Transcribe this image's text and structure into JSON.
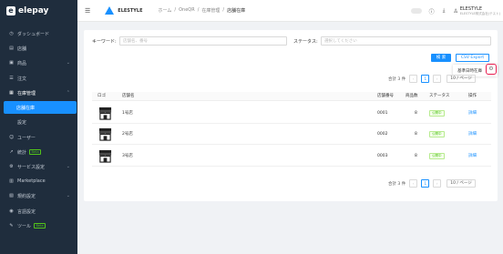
{
  "brand": {
    "name": "elepay",
    "mark": "e"
  },
  "sidebar": {
    "items": [
      {
        "label": "ダッシュボード",
        "icon": "dashboard-icon",
        "glyph": "◷"
      },
      {
        "label": "店舗",
        "icon": "store-icon",
        "glyph": "▤"
      },
      {
        "label": "商品",
        "icon": "product-icon",
        "glyph": "▣"
      },
      {
        "label": "注文",
        "icon": "order-icon",
        "glyph": "☰"
      },
      {
        "label": "在庫管理",
        "icon": "inventory-icon",
        "glyph": "▦"
      },
      {
        "label": "店舗在庫",
        "icon": "",
        "glyph": ""
      },
      {
        "label": "設定",
        "icon": "",
        "glyph": ""
      },
      {
        "label": "ユーザー",
        "icon": "user-icon",
        "glyph": "☺"
      },
      {
        "label": "統計",
        "icon": "stats-icon",
        "glyph": "↗",
        "badge": "Beta"
      },
      {
        "label": "サービス設定",
        "icon": "service-icon",
        "glyph": "⚙"
      },
      {
        "label": "Marketplace",
        "icon": "marketplace-icon",
        "glyph": "▥"
      },
      {
        "label": "規約設定",
        "icon": "terms-icon",
        "glyph": "▧"
      },
      {
        "label": "言語設定",
        "icon": "language-icon",
        "glyph": "◉"
      },
      {
        "label": "ツール",
        "icon": "tool-icon",
        "glyph": "✎",
        "badge": "Beta"
      }
    ]
  },
  "header": {
    "org_name": "ELESTYLE",
    "breadcrumb": [
      "ホーム",
      "OneQR",
      "在庫管理",
      "店舗在庫"
    ],
    "user_name": "ELESTYLE",
    "user_sub": "ELESTYLE株式会社(テスト)"
  },
  "filters": {
    "keyword_label": "キーワード:",
    "keyword_placeholder": "店舗名、番号",
    "status_label": "ステータス:",
    "status_placeholder": "選択してください",
    "search_button": "検 索",
    "export_button": "CSV Export"
  },
  "popup": {
    "label": "基準日時在庫"
  },
  "pagination": {
    "total": "合計 3 件",
    "current": "1",
    "page_size": "10 / ページ"
  },
  "table": {
    "headers": [
      "ロゴ",
      "店舗名",
      "店舗番号",
      "商品数",
      "ステータス",
      "操作"
    ],
    "rows": [
      {
        "name": "1号店",
        "number": "0001",
        "count": "8",
        "status": "公開中",
        "action": "詳細"
      },
      {
        "name": "2号店",
        "number": "0002",
        "count": "8",
        "status": "公開中",
        "action": "詳細"
      },
      {
        "name": "3号店",
        "number": "0003",
        "count": "8",
        "status": "公開中",
        "action": "詳細"
      }
    ]
  },
  "colors": {
    "primary": "#1890ff",
    "sidebar_bg": "#1f2d3d",
    "status_green": "#52c41a",
    "highlight": "#e81c4f"
  }
}
